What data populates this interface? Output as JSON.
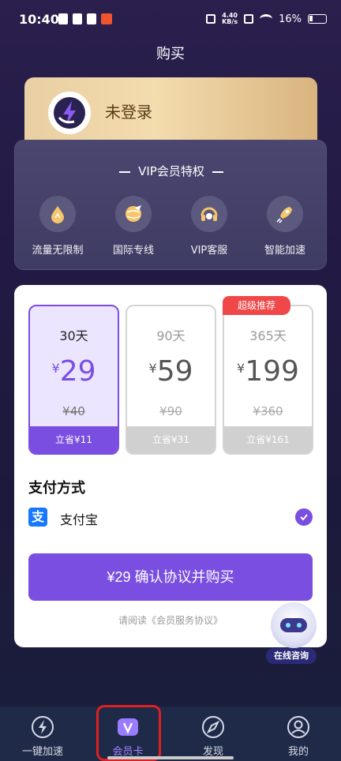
{
  "status_bar": {
    "time": "10:40",
    "net_speed_top": "4.40",
    "net_speed_bottom": "KB/s",
    "battery": "16%"
  },
  "header": {
    "title": "购买"
  },
  "login_card": {
    "text": "未登录"
  },
  "vip_panel": {
    "title": "VIP会员特权",
    "perks": [
      {
        "label": "流量无限制",
        "icon": "rocket-drop-icon"
      },
      {
        "label": "国际专线",
        "icon": "globe-plane-icon"
      },
      {
        "label": "VIP客服",
        "icon": "headset-icon"
      },
      {
        "label": "智能加速",
        "icon": "rocket-icon"
      }
    ]
  },
  "plans": [
    {
      "days": "30天",
      "currency": "¥",
      "price": "29",
      "original": "¥40",
      "save": "立省¥11",
      "selected": true
    },
    {
      "days": "90天",
      "currency": "¥",
      "price": "59",
      "original": "¥90",
      "save": "立省¥31",
      "selected": false
    },
    {
      "days": "365天",
      "currency": "¥",
      "price": "199",
      "original": "¥360",
      "save": "立省¥161",
      "selected": false,
      "badge": "超级推荐"
    }
  ],
  "payment": {
    "title": "支付方式",
    "method": "支付宝",
    "method_icon": "alipay-icon"
  },
  "buy_button": {
    "label": "¥29  确认协议并购买"
  },
  "agreement": {
    "text": "请阅读《会员服务协议》"
  },
  "consult": {
    "label": "在线咨询"
  },
  "bottom_nav": {
    "items": [
      {
        "label": "一键加速",
        "icon": "lightning-icon"
      },
      {
        "label": "会员卡",
        "icon": "vip-card-icon"
      },
      {
        "label": "发现",
        "icon": "compass-icon"
      },
      {
        "label": "我的",
        "icon": "user-icon"
      }
    ],
    "active_index": 1
  },
  "colors": {
    "accent": "#7a4ee0",
    "badge": "#f04848",
    "gold_card": "#f3dcae",
    "nav_bg": "#1e2a48"
  }
}
